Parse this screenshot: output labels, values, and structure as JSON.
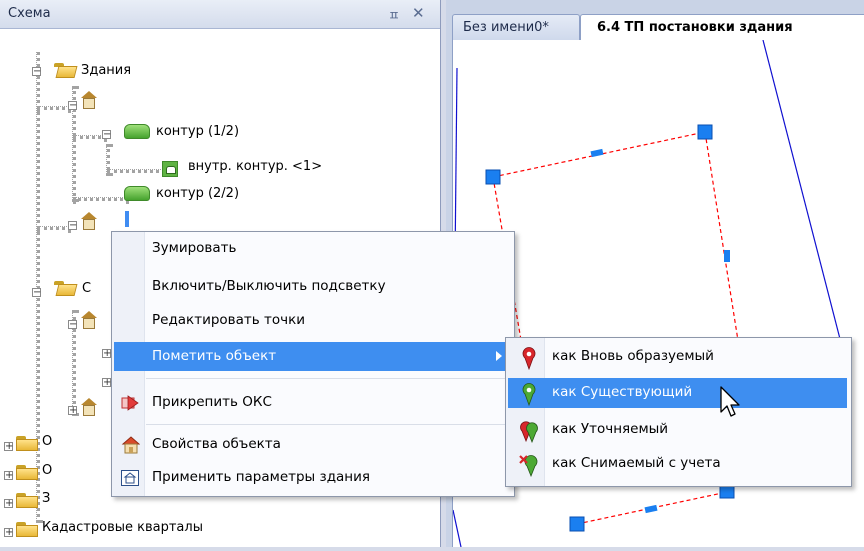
{
  "panel": {
    "title": "Схема",
    "pin_glyph": "ㅍ",
    "close_glyph": "✕"
  },
  "tree": {
    "root_buildings": "Здания",
    "contour_1": "контур (1/2)",
    "inner_contour": "внутр. контур. <1>",
    "contour_2": "контур (2/2)",
    "folder_partial_c": "С",
    "folder_partial_o1": "О",
    "folder_partial_o2": "О",
    "folder_partial_z": "З",
    "cadastral": "Кадастровые кварталы"
  },
  "tabs": {
    "inactive": "Без имени0*",
    "active": "6.4 ТП постановки здания"
  },
  "context_menu": {
    "items": [
      {
        "label": "Зумировать"
      },
      {
        "label": "Включить/Выключить подсветку"
      },
      {
        "label": "Редактировать точки"
      },
      {
        "label": "Пометить объект"
      },
      {
        "label": "Прикрепить ОКС"
      },
      {
        "label": "Свойства объекта"
      },
      {
        "label": "Применить параметры здания"
      }
    ]
  },
  "submenu": {
    "items": [
      {
        "label": "как Вновь образуемый",
        "icon": "red-pin-icon"
      },
      {
        "label": "как Существующий",
        "icon": "green-pin-icon"
      },
      {
        "label": "как Уточняемый",
        "icon": "red-green-pin-icon"
      },
      {
        "label": "как Снимаемый с учета",
        "icon": "green-pin-x-icon"
      }
    ]
  },
  "colors": {
    "selection": "#3e8ef0",
    "vertex": "#1a7ff0",
    "contour_line": "#ff0000",
    "outline_line": "#1010d0"
  }
}
